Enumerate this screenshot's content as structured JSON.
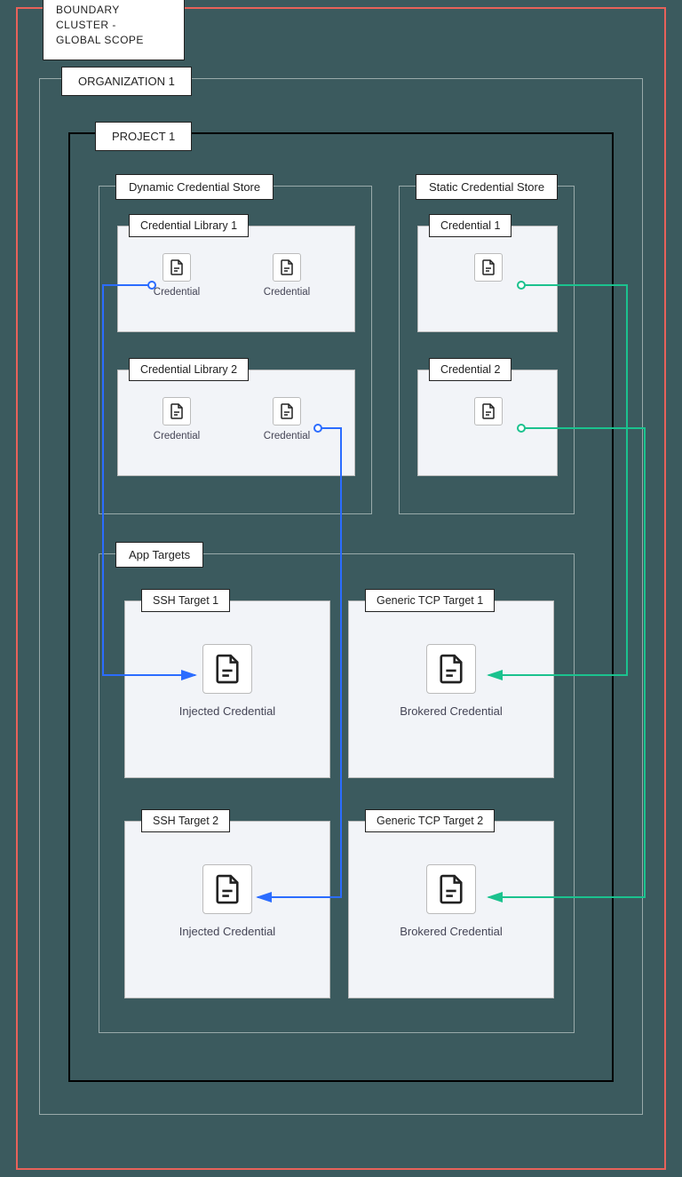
{
  "global": {
    "title_line1": "BOUNDARY CLUSTER -",
    "title_line2": "GLOBAL SCOPE"
  },
  "organization": {
    "title": "ORGANIZATION 1"
  },
  "project": {
    "title": "PROJECT 1"
  },
  "dynamic_store": {
    "title": "Dynamic Credential Store",
    "lib1": {
      "title": "Credential Library 1",
      "cred_a": "Credential",
      "cred_b": "Credential"
    },
    "lib2": {
      "title": "Credential Library 2",
      "cred_a": "Credential",
      "cred_b": "Credential"
    }
  },
  "static_store": {
    "title": "Static Credential Store",
    "cred1": {
      "title": "Credential 1"
    },
    "cred2": {
      "title": "Credential 2"
    }
  },
  "app_targets": {
    "title": "App Targets",
    "ssh1": {
      "title": "SSH Target 1",
      "label": "Injected Credential"
    },
    "tcp1": {
      "title": "Generic TCP Target 1",
      "label": "Brokered Credential"
    },
    "ssh2": {
      "title": "SSH Target 2",
      "label": "Injected Credential"
    },
    "tcp2": {
      "title": "Generic TCP Target 2",
      "label": "Brokered Credential"
    }
  },
  "colors": {
    "blue": "#2b6cff",
    "green": "#1bc28e",
    "red_border": "#e8625a"
  },
  "connections": [
    {
      "from": "dynamic_store.lib1.cred_a",
      "to": "app_targets.ssh1",
      "type": "injected",
      "color": "blue"
    },
    {
      "from": "dynamic_store.lib2.cred_b",
      "to": "app_targets.ssh2",
      "type": "injected",
      "color": "blue"
    },
    {
      "from": "static_store.cred1",
      "to": "app_targets.tcp1",
      "type": "brokered",
      "color": "green"
    },
    {
      "from": "static_store.cred2",
      "to": "app_targets.tcp2",
      "type": "brokered",
      "color": "green"
    }
  ]
}
